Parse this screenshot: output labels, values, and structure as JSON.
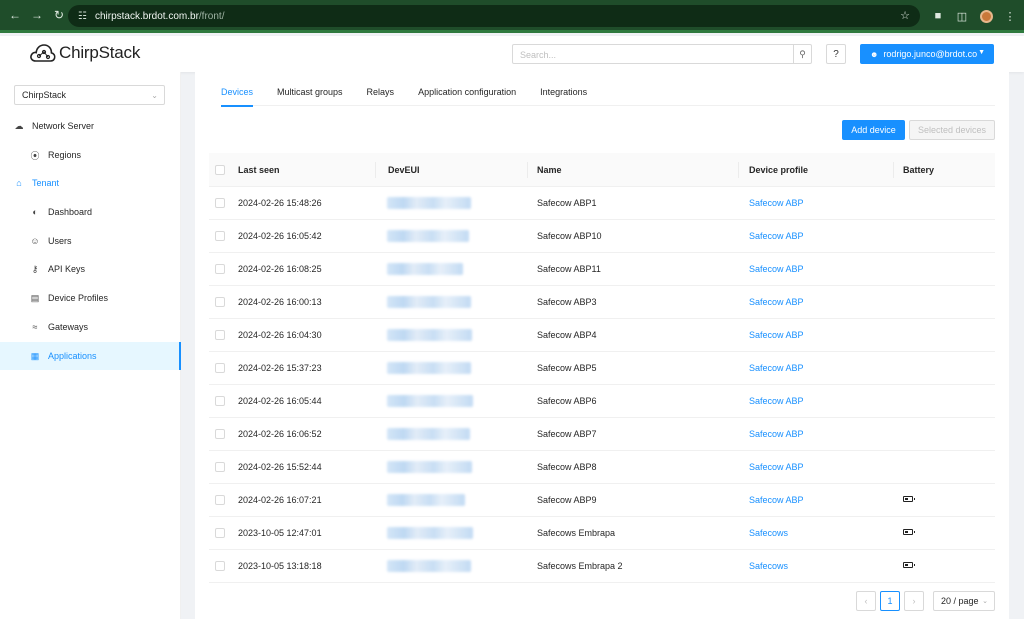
{
  "browser": {
    "url_host": "chirpstack.brdot.com.br",
    "url_path": "/front/"
  },
  "header": {
    "logo_text": "ChirpStack",
    "search_placeholder": "Search...",
    "help_label": "?",
    "user_email": "rodrigo.junco@brdot.co"
  },
  "sidebar": {
    "tenant_select": "ChirpStack",
    "items": [
      {
        "label": "Network Server",
        "icon": "cloud-icon",
        "kind": "top"
      },
      {
        "label": "Regions",
        "icon": "compass-icon",
        "kind": "sub"
      },
      {
        "label": "Tenant",
        "icon": "home-icon",
        "kind": "tenant"
      },
      {
        "label": "Dashboard",
        "icon": "dashboard-icon",
        "kind": "sub"
      },
      {
        "label": "Users",
        "icon": "user-icon",
        "kind": "sub"
      },
      {
        "label": "API Keys",
        "icon": "key-icon",
        "kind": "sub"
      },
      {
        "label": "Device Profiles",
        "icon": "profile-icon",
        "kind": "sub"
      },
      {
        "label": "Gateways",
        "icon": "wifi-icon",
        "kind": "sub"
      },
      {
        "label": "Applications",
        "icon": "apps-icon",
        "kind": "active"
      }
    ]
  },
  "tabs": [
    "Devices",
    "Multicast groups",
    "Relays",
    "Application configuration",
    "Integrations"
  ],
  "buttons": {
    "add_device": "Add device",
    "selected_devices": "Selected devices"
  },
  "table": {
    "columns": [
      "Last seen",
      "DevEUI",
      "Name",
      "Device profile",
      "Battery"
    ],
    "rows": [
      {
        "last_seen": "2024-02-26 15:48:26",
        "name": "Safecow ABP1",
        "profile": "Safecow ABP",
        "battery": false
      },
      {
        "last_seen": "2024-02-26 16:05:42",
        "name": "Safecow ABP10",
        "profile": "Safecow ABP",
        "battery": false
      },
      {
        "last_seen": "2024-02-26 16:08:25",
        "name": "Safecow ABP11",
        "profile": "Safecow ABP",
        "battery": false
      },
      {
        "last_seen": "2024-02-26 16:00:13",
        "name": "Safecow ABP3",
        "profile": "Safecow ABP",
        "battery": false
      },
      {
        "last_seen": "2024-02-26 16:04:30",
        "name": "Safecow ABP4",
        "profile": "Safecow ABP",
        "battery": false
      },
      {
        "last_seen": "2024-02-26 15:37:23",
        "name": "Safecow ABP5",
        "profile": "Safecow ABP",
        "battery": false
      },
      {
        "last_seen": "2024-02-26 16:05:44",
        "name": "Safecow ABP6",
        "profile": "Safecow ABP",
        "battery": false
      },
      {
        "last_seen": "2024-02-26 16:06:52",
        "name": "Safecow ABP7",
        "profile": "Safecow ABP",
        "battery": false
      },
      {
        "last_seen": "2024-02-26 15:52:44",
        "name": "Safecow ABP8",
        "profile": "Safecow ABP",
        "battery": false
      },
      {
        "last_seen": "2024-02-26 16:07:21",
        "name": "Safecow ABP9",
        "profile": "Safecow ABP",
        "battery": true
      },
      {
        "last_seen": "2023-10-05 12:47:01",
        "name": "Safecows Embrapa",
        "profile": "Safecows",
        "battery": true
      },
      {
        "last_seen": "2023-10-05 13:18:18",
        "name": "Safecows Embrapa 2",
        "profile": "Safecows",
        "battery": true
      }
    ]
  },
  "pagination": {
    "prev": "‹",
    "current_page": "1",
    "next": "›",
    "page_size": "20 / page"
  },
  "colors": {
    "primary": "#1890ff",
    "chrome": "#1f4d2a"
  }
}
